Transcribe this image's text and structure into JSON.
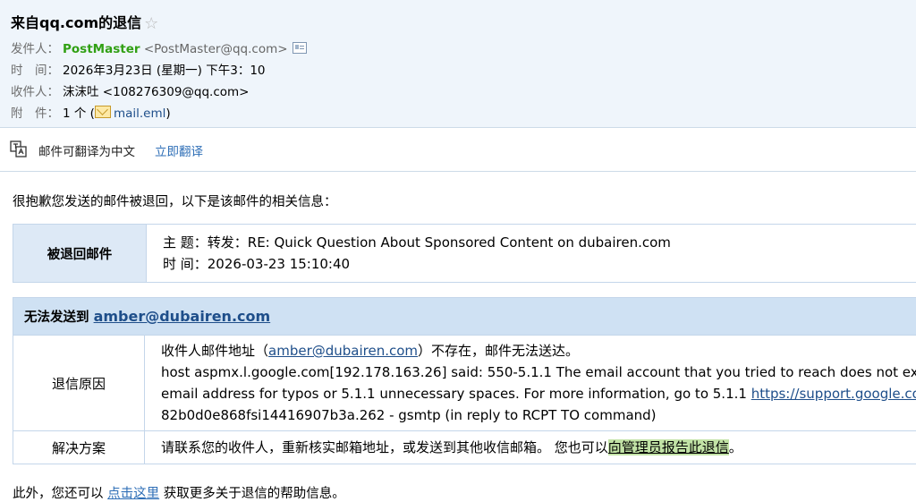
{
  "header": {
    "subject": "来自qq.com的退信",
    "star_icon": "star-icon",
    "from_label": "发件人：",
    "from_name": "PostMaster",
    "from_addr": "<PostMaster@qq.com>",
    "time_label": "时　间：",
    "time_value": "2026年3月23日 (星期一) 下午3：10",
    "to_label": "收件人：",
    "to_value": "沫沫吐 <108276309@qq.com>",
    "attach_label": "附　件：",
    "attach_count": "1 个 (",
    "attach_name": "mail.eml",
    "attach_close": ")"
  },
  "translate": {
    "text": "邮件可翻译为中文",
    "link": "立即翻译"
  },
  "body": {
    "intro": "很抱歉您发送的邮件被退回，以下是该邮件的相关信息：",
    "bounced_label": "被退回邮件",
    "subject_line": "主 题：转发：RE: Quick Question About Sponsored Content on dubairen.com",
    "time_line": "时 间：2026-03-23 15:10:40",
    "cannot_send_label": "无法发送到",
    "cannot_send_addr": "amber@dubairen.com",
    "reason_label": "退信原因",
    "reason_line1_pre": "收件人邮件地址（",
    "reason_line1_addr": "amber@dubairen.com",
    "reason_line1_post": "）不存在，邮件无法送达。",
    "reason_line2": "host aspmx.l.google.com[192.178.163.26] said: 550-5.1.1 The email account that you tried to reach does not exist.",
    "reason_line3_pre": "email address for typos or 5.1.1 unnecessary spaces. For more information, go to 5.1.1  ",
    "reason_line3_link": "https://support.google.com/mail",
    "reason_line4": "82b0d0e868fsi14416907b3a.262 - gsmtp (in reply to RCPT TO command)",
    "solution_label": "解决方案",
    "solution_pre": "请联系您的收件人，重新核实邮箱地址，或发送到其他收信邮箱。  您也可以",
    "solution_link": "向管理员报告此退信",
    "solution_post": "。",
    "footer_pre": "此外，您还可以 ",
    "footer_link": "点击这里",
    "footer_post": " 获取更多关于退信的帮助信息。"
  }
}
